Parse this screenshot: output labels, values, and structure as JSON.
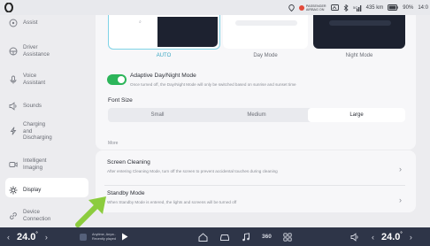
{
  "status_bar": {
    "airbag_line1": "PASSENGER",
    "airbag_line2": "AIRBAG ON",
    "range": "435 km",
    "battery": "90%",
    "time": "14:0"
  },
  "sidebar": {
    "items": [
      {
        "label": "Assist",
        "icon": "steering-icon"
      },
      {
        "label": "Driver\nAssistance",
        "icon": "driver-assist-icon"
      },
      {
        "label": "Voice\nAssistant",
        "icon": "voice-icon"
      },
      {
        "label": "Sounds",
        "icon": "speaker-icon"
      },
      {
        "label": "Charging\nand\nDischarging",
        "icon": "charging-icon"
      },
      {
        "label": "Intelligent\nImaging",
        "icon": "camera-icon"
      },
      {
        "label": "Display",
        "icon": "brightness-icon"
      },
      {
        "label": "Device\nConnection",
        "icon": "link-icon"
      }
    ]
  },
  "display": {
    "modes": [
      "AUTO",
      "Day Mode",
      "Night Mode"
    ],
    "selected_mode": "AUTO",
    "adaptive_title": "Adaptive Day/Night Mode",
    "adaptive_desc": "Once turned off, the Day/Night Mode will only be switched based on sunrise and sunset time",
    "adaptive_on": true,
    "font_size_title": "Font Size",
    "font_sizes": [
      "Small",
      "Medium",
      "Large"
    ],
    "selected_font_size": "Large",
    "more_label": "More",
    "screen_cleaning_title": "Screen Cleaning",
    "screen_cleaning_desc": "After entering Cleaning Mode, turn off the screen to prevent accidental touches during cleaning",
    "standby_title": "Standby Mode",
    "standby_desc": "When Standby Mode is entered, the lights and screens will be turned off"
  },
  "bottom_bar": {
    "temp_left": "24.0",
    "temp_right": "24.0",
    "music_line1": "Anytime, Anyw..",
    "music_line2": "Recently played"
  },
  "colors": {
    "accent_cyan": "#7fd3e6",
    "toggle_green": "#2cb55a",
    "arrow_green": "#8ccc3e",
    "bottom_bar": "#2e3548"
  }
}
